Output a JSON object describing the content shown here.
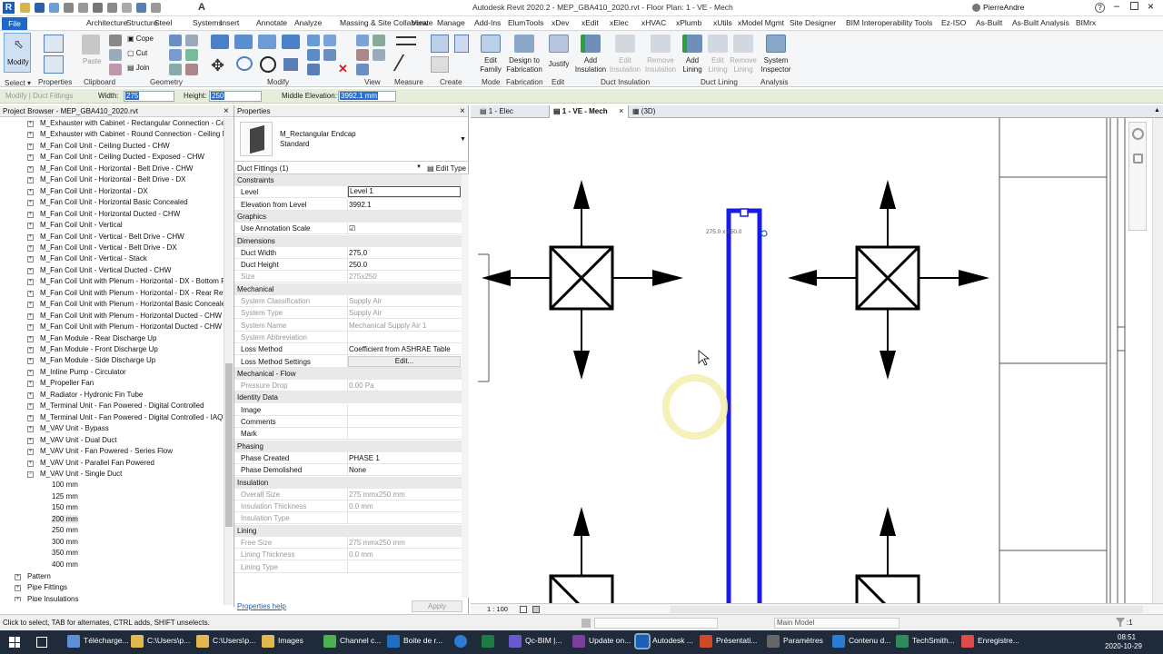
{
  "app": {
    "title": "Autodesk Revit 2020.2 - MEP_GBA410_2020.rvt - Floor Plan: 1 - VE - Mech",
    "user": "PierreAndre"
  },
  "menu": [
    "File",
    "Architecture",
    "Structure",
    "Steel",
    "Systems",
    "Insert",
    "Annotate",
    "Analyze",
    "Massing & Site",
    "Collaborate",
    "View",
    "Manage",
    "Add-Ins",
    "ElumTools",
    "xDev",
    "xEdit",
    "xElec",
    "xHVAC",
    "xPlumb",
    "xUtils",
    "xModel Mgmt",
    "Site Designer",
    "BIM Interoperability Tools",
    "Ez-ISO",
    "As-Built",
    "As-Built Analysis",
    "BIMrx"
  ],
  "ribbon": {
    "modify": "Modify",
    "paste": "Paste",
    "cope": "Cope",
    "cut": "Cut",
    "join": "Join",
    "groups": {
      "select": "Select",
      "properties": "Properties",
      "clipboard": "Clipboard",
      "geometry": "Geometry",
      "modify": "Modify",
      "view": "View",
      "measure": "Measure",
      "create": "Create",
      "mode": "Mode",
      "fabrication": "Fabrication",
      "edit": "Edit",
      "duct_insulation": "Duct Insulation",
      "duct_lining": "Duct Lining",
      "analysis": "Analysis"
    },
    "buttons": {
      "edit_family": "Edit Family",
      "design_fab": "Design to Fabrication",
      "justify": "Justify",
      "add_ins": "Add Insulation",
      "edit_ins": "Edit Insulation",
      "remove_ins": "Remove Insulation",
      "add_lining": "Add Lining",
      "edit_lining": "Edit Lining",
      "remove_lining": "Remove Lining",
      "sys_inspector": "System Inspector"
    }
  },
  "options": {
    "modify_label": "Modify | Duct Fittings",
    "width_label": "Width:",
    "width": "275",
    "height_label": "Height:",
    "height": "250",
    "mid_label": "Middle Elevation:",
    "mid": "3992.1 mm"
  },
  "browser": {
    "title": "Project Browser - MEP_GBA410_2020.rvt",
    "items": [
      "M_Exhauster with Cabinet - Rectangular Connection - Cei",
      "M_Exhauster with Cabinet - Round Connection - Ceiling M",
      "M_Fan Coil Unit - Ceiling Ducted - CHW",
      "M_Fan Coil Unit - Ceiling Ducted - Exposed - CHW",
      "M_Fan Coil Unit - Horizontal - Belt Drive - CHW",
      "M_Fan Coil Unit - Horizontal - Belt Drive - DX",
      "M_Fan Coil Unit - Horizontal - DX",
      "M_Fan Coil Unit - Horizontal Basic Concealed",
      "M_Fan Coil Unit - Horizontal Ducted - CHW",
      "M_Fan Coil Unit - Vertical",
      "M_Fan Coil Unit - Vertical - Belt Drive - CHW",
      "M_Fan Coil Unit - Vertical - Belt Drive - DX",
      "M_Fan Coil Unit - Vertical - Stack",
      "M_Fan Coil Unit - Vertical Ducted - CHW",
      "M_Fan Coil Unit with Plenum - Horizontal - DX - Bottom F",
      "M_Fan Coil Unit with Plenum - Horizontal - DX - Rear Retu",
      "M_Fan Coil Unit with Plenum - Horizontal Basic Concealec",
      "M_Fan Coil Unit with Plenum - Horizontal Ducted - CHW",
      "M_Fan Coil Unit with Plenum - Horizontal Ducted - CHW -",
      "M_Fan Module - Rear Discharge Up",
      "M_Fan Module - Front Discharge Up",
      "M_Fan Module - Side Discharge Up",
      "M_Inline Pump - Circulator",
      "M_Propeller Fan",
      "M_Radiator - Hydronic Fin Tube",
      "M_Terminal Unit - Fan Powered - Digital Controlled",
      "M_Terminal Unit - Fan Powered - Digital Controlled - IAQ",
      "M_VAV Unit - Bypass",
      "M_VAV Unit - Dual Duct",
      "M_VAV Unit - Fan Powered - Series Flow",
      "M_VAV Unit - Parallel Fan Powered",
      "M_VAV Unit - Single Duct"
    ],
    "sizes": [
      "100 mm",
      "125 mm",
      "150 mm",
      "200 mm",
      "250 mm",
      "300 mm",
      "350 mm",
      "400 mm"
    ],
    "roots": [
      "Pattern",
      "Pipe Fittings",
      "Pipe Insulations"
    ]
  },
  "props": {
    "title": "Properties",
    "family": "M_Rectangular Endcap",
    "type": "Standard",
    "filter": "Duct Fittings (1)",
    "edit_type": "Edit Type",
    "sections": [
      {
        "name": "Constraints",
        "rows": [
          [
            "Level",
            "Level 1",
            0
          ],
          [
            "Elevation from Level",
            "3992.1",
            0
          ]
        ]
      },
      {
        "name": "Graphics",
        "rows": [
          [
            "Use Annotation Scale",
            "☑",
            0
          ]
        ]
      },
      {
        "name": "Dimensions",
        "rows": [
          [
            "Duct Width",
            "275.0",
            0
          ],
          [
            "Duct Height",
            "250.0",
            0
          ],
          [
            "Size",
            "275x250",
            1
          ]
        ]
      },
      {
        "name": "Mechanical",
        "rows": [
          [
            "System Classification",
            "Supply Air",
            1
          ],
          [
            "System Type",
            "Supply Air",
            1
          ],
          [
            "System Name",
            "Mechanical Supply Air 1",
            1
          ],
          [
            "System Abbreviation",
            "",
            1
          ],
          [
            "Loss Method",
            "Coefficient from ASHRAE Table",
            0
          ],
          [
            "Loss Method Settings",
            "Edit...",
            0
          ]
        ]
      },
      {
        "name": "Mechanical - Flow",
        "rows": [
          [
            "Pressure Drop",
            "0.00 Pa",
            1
          ]
        ]
      },
      {
        "name": "Identity Data",
        "rows": [
          [
            "Image",
            "",
            0
          ],
          [
            "Comments",
            "",
            0
          ],
          [
            "Mark",
            "",
            0
          ]
        ]
      },
      {
        "name": "Phasing",
        "rows": [
          [
            "Phase Created",
            "PHASE 1",
            0
          ],
          [
            "Phase Demolished",
            "None",
            0
          ]
        ]
      },
      {
        "name": "Insulation",
        "rows": [
          [
            "Overall Size",
            "275 mmx250 mm",
            1
          ],
          [
            "Insulation Thickness",
            "0.0 mm",
            1
          ],
          [
            "Insulation Type",
            "",
            1
          ]
        ]
      },
      {
        "name": "Lining",
        "rows": [
          [
            "Free Size",
            "275 mmx250 mm",
            1
          ],
          [
            "Lining Thickness",
            "0.0 mm",
            1
          ],
          [
            "Lining Type",
            "",
            1
          ]
        ]
      }
    ],
    "help": "Properties help",
    "apply": "Apply"
  },
  "view": {
    "tabs": [
      "1 - Elec",
      "1 - VE - Mech",
      "(3D)"
    ],
    "dim": "275.0 x 250.0",
    "scale": "1 : 100",
    "model": "Main Model",
    "selcount": ":1"
  },
  "status": {
    "text": "Click to select, TAB for alternates, CTRL adds, SHIFT unselects."
  },
  "taskbar": {
    "items": [
      "Télécharge...",
      "C:\\Users\\p...",
      "C:\\Users\\p...",
      "Images",
      "Channel c...",
      "Boite de r...",
      "Qc-BIM |...",
      "Update on...",
      "Autodesk ...",
      "Présentati...",
      "Paramètres",
      "Contenu d...",
      "TechSmith...",
      "Enregistre..."
    ],
    "time": "08:51",
    "date": "2020-10-29"
  },
  "colors": {
    "file": "#1b6ac9",
    "duct": "#1a1ae6",
    "option": "#e6edda",
    "taskbar": "#1f2b3a"
  }
}
